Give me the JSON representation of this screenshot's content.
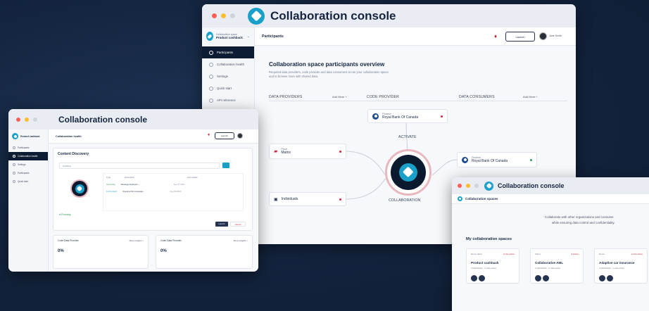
{
  "main_window": {
    "title": "Collaboration console",
    "workspace_label": "Collaboration space",
    "workspace_name": "Product cashback",
    "sidebar": [
      {
        "label": "Participants"
      },
      {
        "label": "Collaboration health"
      },
      {
        "label": "Settings"
      },
      {
        "label": "Quick start"
      },
      {
        "label": "API reference"
      }
    ],
    "page_title": "Participants",
    "button_label": "Launch",
    "user_label": "Jane Smith",
    "heading": "Collaboration space participants overview",
    "description_1": "Required data providers, code provider and data consumers to run your collaboration space",
    "description_2": "and to browse more with shared data.",
    "col_data_providers": "DATA PROVIDERS",
    "col_code_provider": "CODE PROVIDER",
    "col_data_consumers": "DATA CONSUMERS",
    "add_more": "Add More +",
    "code_provider_small": "Finance",
    "code_provider_name": "Royal Bank Of Canada",
    "provider_1_small": "Pearl",
    "provider_1_name": "Matrix",
    "provider_2_name": "Individuals",
    "consumer_small": "Finance",
    "consumer_name": "Royal Bank Of Canada",
    "status_top": "ACTIVATE",
    "status_bottom": "COLLABORATION"
  },
  "left_window": {
    "title": "Collaboration console",
    "workspace_name": "Product cashback",
    "sidebar": [
      {
        "label": "Participants"
      },
      {
        "label": "Collaboration health"
      },
      {
        "label": "Settings"
      },
      {
        "label": "Participants"
      },
      {
        "label": "Quick start"
      }
    ],
    "page_title": "Collaboration health",
    "button_label": "Launch",
    "section_title": "Content Discovery",
    "search_placeholder": "Anything",
    "table_headers": [
      "Type",
      "Description",
      "Last update"
    ],
    "rows": [
      {
        "type": "Upcoming",
        "desc": "Message deployed —",
        "date": "Sep 07 2023"
      },
      {
        "type": "Full Content",
        "desc": "Opening first messages",
        "date": "Aug 09 2023"
      }
    ],
    "running_label": "● Running",
    "card_1_title": "Code Data Provider",
    "card_2_title": "Code Data Provider",
    "card_link": "More insights >",
    "percent_1": "0%",
    "percent_2": "0%",
    "run_button": "Launch",
    "stop_button": "Cancel"
  },
  "right_window": {
    "title": "Collaboration console",
    "page_title": "Collaboration spaces",
    "tagline_1": "Collaborate with other organizations and consume",
    "tagline_2": "while ensuring data control and confidentiality.",
    "section_title": "My collaboration spaces",
    "spaces": [
      {
        "tag": "Demo client",
        "status": "● Not active",
        "name": "Product cashback",
        "meta": "3 participants · 1 code owner"
      },
      {
        "tag": "Client",
        "status": "● Active",
        "name": "Collaborative AML",
        "meta": "4 participants · 1 code owner"
      },
      {
        "tag": "Demo",
        "status": "● Not active",
        "name": "Adaptive car insurance",
        "meta": "3 participants · 1 code owner"
      }
    ]
  },
  "colors": {
    "background": "#13233d",
    "accent": "#1aa0c8",
    "navy": "#0d1b33",
    "alert_red": "#d0253f"
  }
}
